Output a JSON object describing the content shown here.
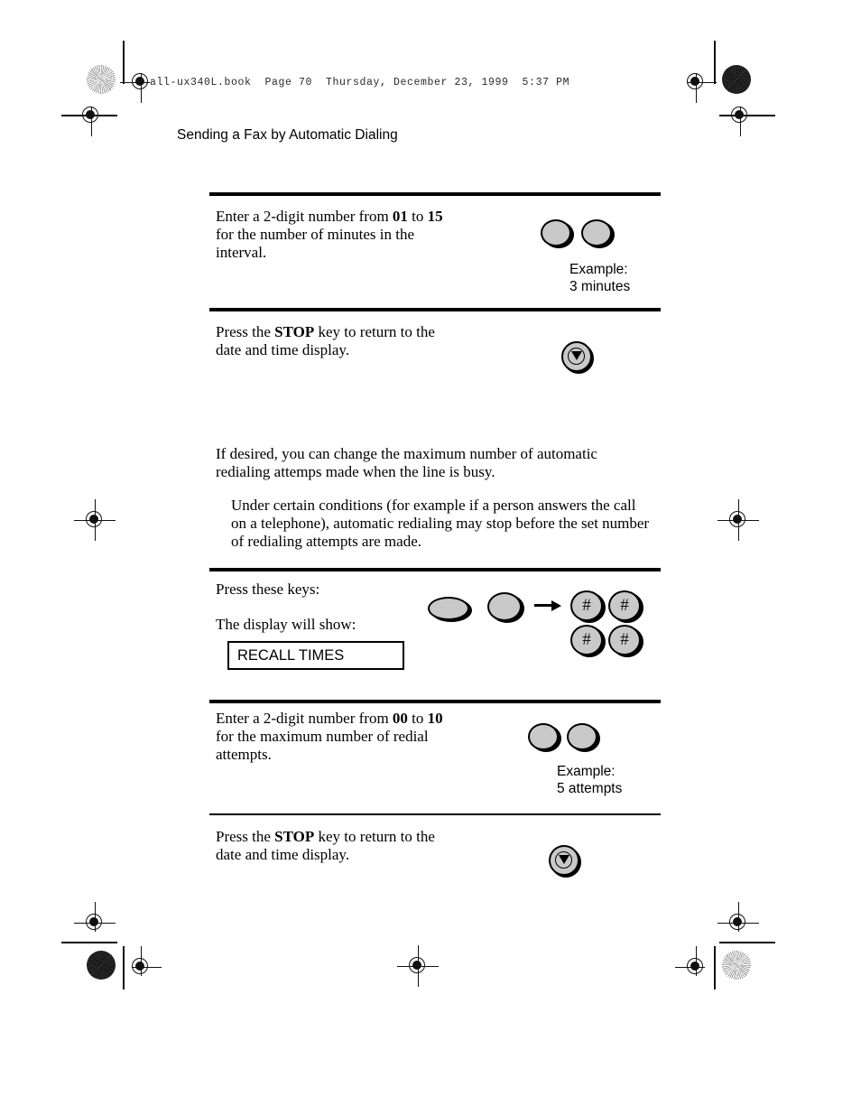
{
  "document": {
    "running_header": "all-ux340L.book  Page 70  Thursday, December 23, 1999  5:37 PM",
    "page_title": "Sending a Fax by Automatic Dialing"
  },
  "steps": [
    {
      "id": "interval-entry",
      "text_parts": [
        "Enter a 2-digit number from ",
        "01",
        " to ",
        "15",
        " for the number of minutes in the interval."
      ],
      "text_plain": "Enter a 2-digit number from 01 to 15 for the number of minutes in the interval.",
      "range_min": "01",
      "range_max": "15",
      "example_line1": "Example:",
      "example_line2": "3 minutes",
      "keys": [
        "numeric-key",
        "numeric-key"
      ]
    },
    {
      "id": "stop-1",
      "text_plain": "Press the STOP key to return to the date and time display.",
      "key_label": "STOP"
    },
    {
      "id": "recall-intro",
      "paragraph": "If desired, you can change the maximum number of automatic redialing attemps made when the line is busy.",
      "note": "Under certain conditions (for example if a person answers the call on a telephone), automatic redialing may stop before the set number of redialing attempts are made."
    },
    {
      "id": "press-keys",
      "prompt_keys": "Press these keys:",
      "prompt_display": "The display will show:",
      "lcd_text": "RECALL TIMES",
      "keys": [
        "function-key",
        "round-key",
        "hash-key",
        "hash-key",
        "hash-key",
        "hash-key"
      ],
      "hash_symbol": "#"
    },
    {
      "id": "redial-entry",
      "text_plain": "Enter a 2-digit number from 00 to 10 for the maximum number of redial attempts.",
      "range_min": "00",
      "range_max": "10",
      "example_line1": "Example:",
      "example_line2": "5 attempts",
      "keys": [
        "numeric-key",
        "numeric-key"
      ]
    },
    {
      "id": "stop-2",
      "text_plain": "Press the STOP key to return to the date and time display.",
      "key_label": "STOP"
    }
  ],
  "text": {
    "interval_a": "Enter a 2-digit number from ",
    "interval_b": " to ",
    "interval_c": " for the number of minutes in the",
    "interval_d": "interval.",
    "stop_a": "Press the ",
    "stop_b": " key to return to the",
    "stop_c": "date and time display.",
    "stop_key": "STOP",
    "intro_l1": "If desired, you can change the maximum number of automatic",
    "intro_l2": "redialing attemps made when the line is busy.",
    "note_l1": "Under certain conditions (for example if a person answers the call",
    "note_l2": "on a telephone), automatic redialing may stop before the set number",
    "note_l3": "of redialing attempts are made.",
    "press_keys": "Press these keys:",
    "display_will_show": "The display will show:",
    "lcd": "RECALL TIMES",
    "redial_a": "Enter a 2-digit number from ",
    "redial_b": " to ",
    "redial_c": " for the maximum number of redial",
    "redial_d": "attempts.",
    "range_interval_min": "01",
    "range_interval_max": "15",
    "range_redial_min": "00",
    "range_redial_max": "10",
    "example_label": "Example:",
    "example_minutes": "3 minutes",
    "example_attempts": "5 attempts",
    "hash": "#"
  },
  "colors": {
    "key_fill": "#c9c9c9",
    "ink": "#000000",
    "page": "#ffffff"
  }
}
